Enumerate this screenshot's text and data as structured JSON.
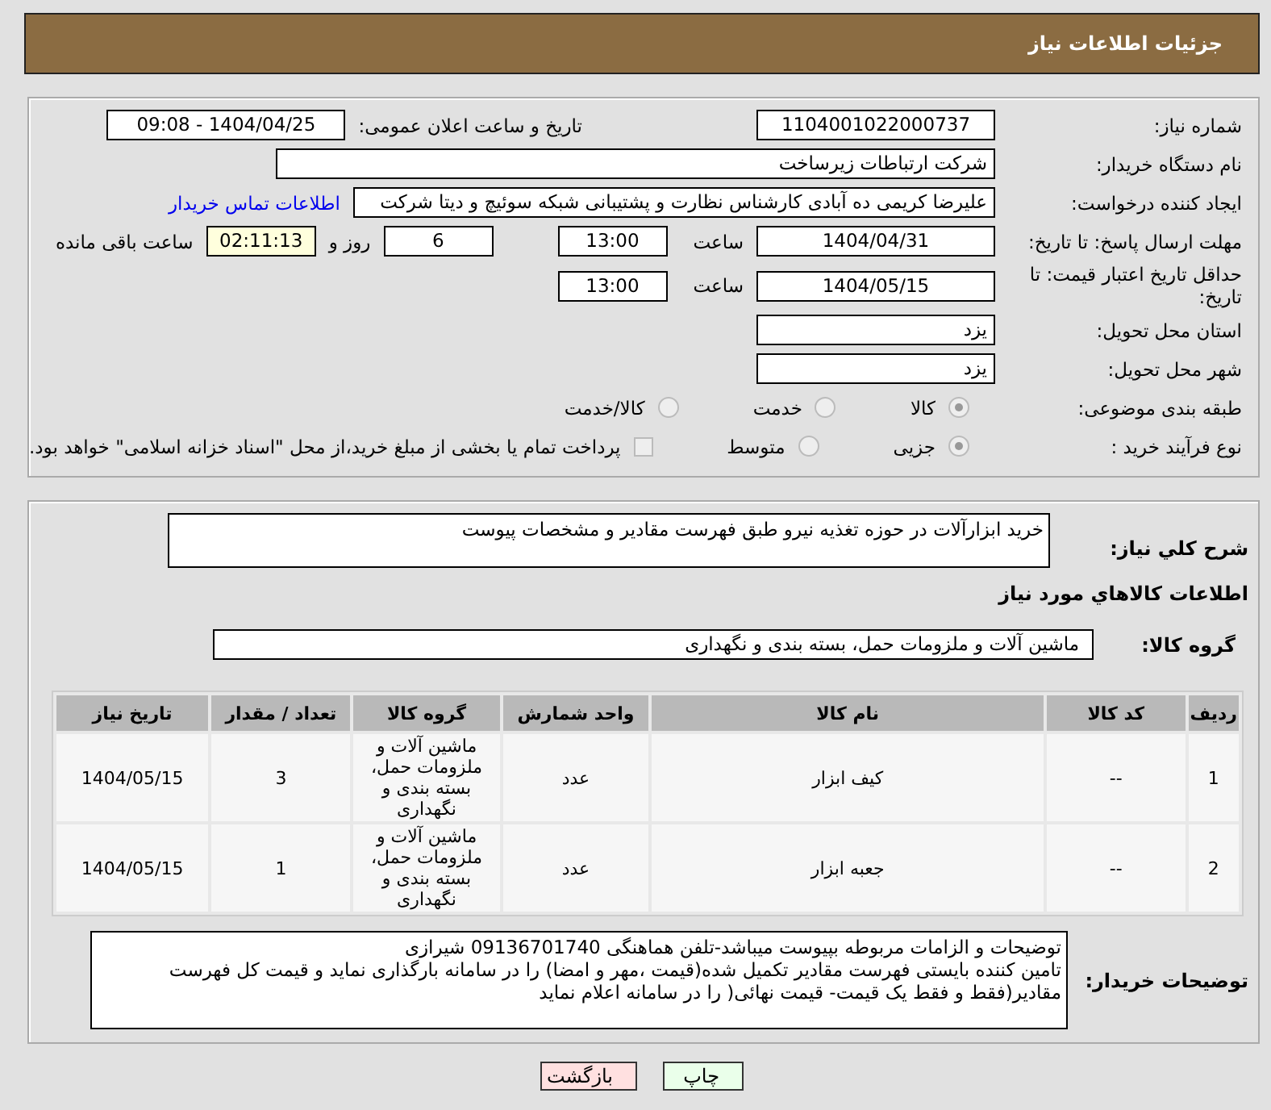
{
  "header": {
    "title": "جزئیات اطلاعات نیاز"
  },
  "need_number": {
    "label": "شماره نیاز:",
    "value": "1104001022000737"
  },
  "announce": {
    "label": "تاریخ و ساعت اعلان عمومی:",
    "value": "1404/04/25 - 09:08"
  },
  "buyer_org": {
    "label": "نام دستگاه خریدار:",
    "value": "شرکت ارتباطات زیرساخت"
  },
  "requester": {
    "label": "ایجاد کننده درخواست:",
    "value": "علیرضا کریمی ده آبادی کارشناس نظارت و پشتیبانی شبکه سوئیچ و دیتا شرکت",
    "link": "اطلاعات تماس خریدار"
  },
  "reply_deadline": {
    "label": "مهلت ارسال پاسخ: تا تاریخ:",
    "date": "1404/04/31",
    "time_label": "ساعت",
    "time": "13:00",
    "days": "6",
    "days_label": "روز و",
    "remaining": "02:11:13",
    "remaining_label": "ساعت باقی مانده"
  },
  "price_validity": {
    "label": "حداقل تاریخ اعتبار قیمت: تا تاریخ:",
    "date": "1404/05/15",
    "time_label": "ساعت",
    "time": "13:00"
  },
  "province": {
    "label": "استان محل تحویل:",
    "value": "یزد"
  },
  "city": {
    "label": "شهر محل تحویل:",
    "value": "یزد"
  },
  "category": {
    "label": "طبقه بندی موضوعی:",
    "options": [
      {
        "label": "کالا",
        "selected": true
      },
      {
        "label": "خدمت",
        "selected": false
      },
      {
        "label": "کالا/خدمت",
        "selected": false
      }
    ]
  },
  "purchase_process": {
    "label": "نوع فرآیند خرید :",
    "options": [
      {
        "label": "جزیی",
        "selected": true
      },
      {
        "label": "متوسط",
        "selected": false
      }
    ],
    "payment": {
      "checked": false,
      "label": "پرداخت تمام یا بخشی از مبلغ خرید،از محل \"اسناد خزانه اسلامی\" خواهد بود."
    }
  },
  "description": {
    "label": "شرح کلي نياز:",
    "value": "خرید ابزارآلات در حوزه تغذیه نیرو طبق فهرست مقادیر و مشخصات پیوست"
  },
  "goods_title": "اطلاعات کالاهاي مورد نياز",
  "goods_group": {
    "label": "گروه کالا:",
    "value": "ماشین آلات و ملزومات حمل، بسته بندی و نگهداری"
  },
  "table": {
    "columns": [
      "ردیف",
      "کد کالا",
      "نام کالا",
      "واحد شمارش",
      "گروه کالا",
      "تعداد / مقدار",
      "تاریخ نیاز"
    ],
    "rows": [
      [
        "1",
        "--",
        "کیف ابزار",
        "عدد",
        "ماشین آلات و ملزومات حمل، بسته بندی و نگهداری",
        "3",
        "1404/05/15"
      ],
      [
        "2",
        "--",
        "جعبه ابزار",
        "عدد",
        "ماشین آلات و ملزومات حمل، بسته بندی و نگهداری",
        "1",
        "1404/05/15"
      ]
    ]
  },
  "buyer_notes": {
    "label": "توضیحات خریدار:",
    "lines": [
      "توضیحات و الزامات مربوطه بپیوست میباشد-تلفن هماهنگی  09136701740 شیرازی",
      "تامین کننده بایستی فهرست مقادیر تکمیل شده(قیمت ،مهر و امضا) را در سامانه بارگذاری نماید و قیمت کل فهرست مقادیر(فقط و فقط یک قیمت- قیمت نهائی( را در سامانه اعلام نماید"
    ]
  },
  "buttons": [
    {
      "label": "چاپ",
      "kind": "print"
    },
    {
      "label": "بازگشت",
      "kind": "back"
    }
  ]
}
